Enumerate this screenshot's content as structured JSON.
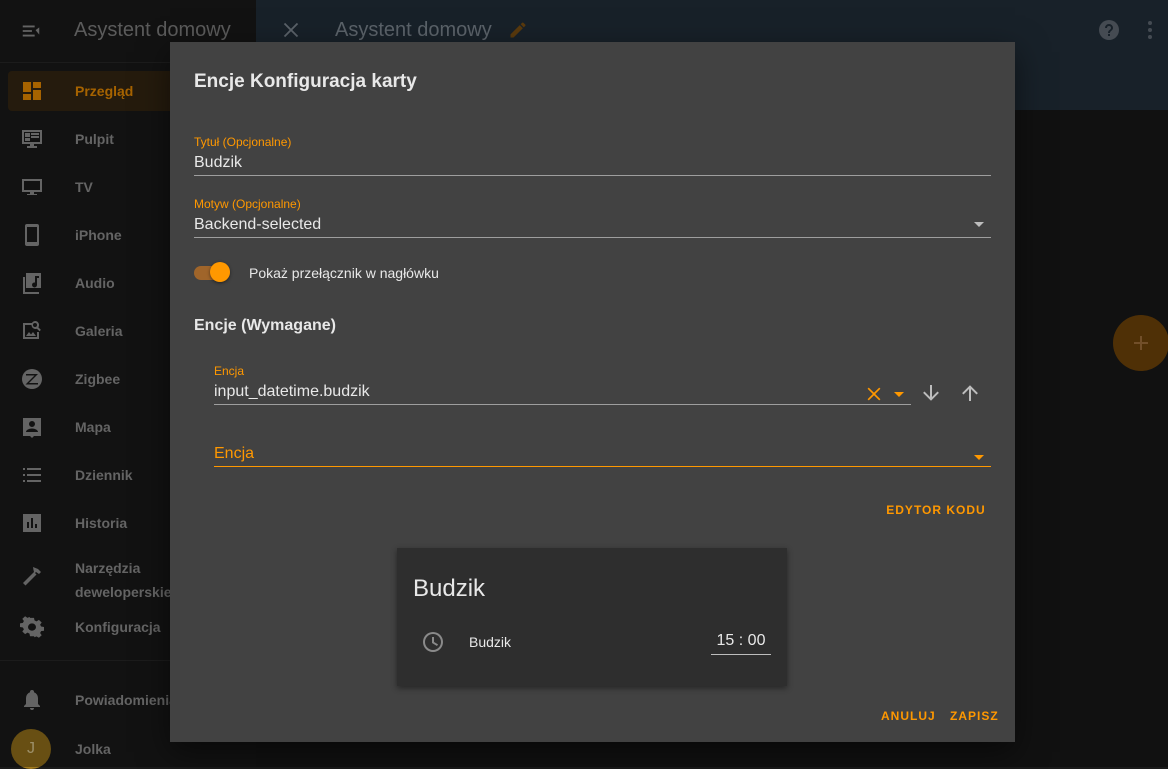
{
  "sidebar": {
    "title": "Asystent domowy",
    "items": [
      {
        "label": "Przegląd",
        "icon": "dashboard-icon",
        "active": true
      },
      {
        "label": "Pulpit",
        "icon": "monitor-dashboard-icon"
      },
      {
        "label": "TV",
        "icon": "tv-icon"
      },
      {
        "label": "iPhone",
        "icon": "cellphone-icon"
      },
      {
        "label": "Audio",
        "icon": "music-box-icon"
      },
      {
        "label": "Galeria",
        "icon": "image-search-icon"
      },
      {
        "label": "Zigbee",
        "icon": "zigbee-icon"
      },
      {
        "label": "Mapa",
        "icon": "account-box-icon"
      },
      {
        "label": "Dziennik",
        "icon": "format-list-bulleted-icon"
      },
      {
        "label": "Historia",
        "icon": "chart-box-icon"
      },
      {
        "label": "Narzędzia deweloperskie",
        "icon": "hammer-icon"
      },
      {
        "label": "Konfiguracja",
        "icon": "cog-icon"
      }
    ],
    "notifications_label": "Powiadomienia",
    "user": {
      "initial": "J",
      "name": "Jolka"
    }
  },
  "topbar": {
    "title": "Asystent domowy"
  },
  "dialog": {
    "title": "Encje Konfiguracja karty",
    "title_field": {
      "label": "Tytuł (Opcjonalne)",
      "value": "Budzik"
    },
    "theme_field": {
      "label": "Motyw (Opcjonalne)",
      "value": "Backend-selected"
    },
    "toggle": {
      "label": "Pokaż przełącznik w nagłówku",
      "on": true
    },
    "entities_heading": "Encje (Wymagane)",
    "entity_row": {
      "label": "Encja",
      "value": "input_datetime.budzik"
    },
    "new_entity": {
      "placeholder": "Encja"
    },
    "code_editor_label": "EDYTOR KODU",
    "preview": {
      "title": "Budzik",
      "entity_name": "Budzik",
      "time_hours": "15",
      "time_separator": ":",
      "time_minutes": "00"
    },
    "cancel_label": "ANULUJ",
    "save_label": "ZAPISZ"
  },
  "colors": {
    "accent": "#ff9800",
    "dialog_bg": "#424242",
    "card_bg": "#2e2e2e"
  }
}
